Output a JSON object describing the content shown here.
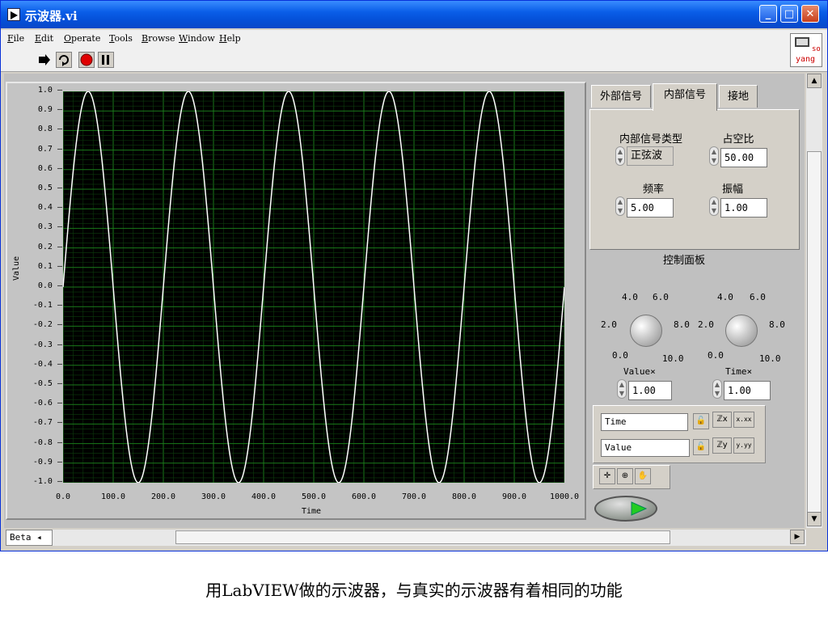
{
  "window": {
    "title": "示波器.vi",
    "controls": {
      "minimize": "_",
      "maximize": "□",
      "close": "✕"
    }
  },
  "menu": [
    {
      "hot": "F",
      "rest": "ile"
    },
    {
      "hot": "E",
      "rest": "dit"
    },
    {
      "hot": "O",
      "rest": "perate"
    },
    {
      "hot": "T",
      "rest": "ools"
    },
    {
      "hot": "B",
      "rest": "rowse"
    },
    {
      "hot": "W",
      "rest": "indow"
    },
    {
      "hot": "H",
      "rest": "elp"
    }
  ],
  "toolbar": {
    "run_icon": "run-arrow-icon",
    "run_continuous_icon": "run-continuously-icon",
    "abort_icon": "abort-icon",
    "pause_icon": "pause-icon"
  },
  "vi_icon_text": {
    "line1": "so",
    "line2": "yang"
  },
  "graph": {
    "xlabel": "Time",
    "ylabel": "Value",
    "xticks": [
      "0.0",
      "100.0",
      "200.0",
      "300.0",
      "400.0",
      "500.0",
      "600.0",
      "700.0",
      "800.0",
      "900.0",
      "1000.0"
    ],
    "yticks": [
      "1.0",
      "0.9",
      "0.8",
      "0.7",
      "0.6",
      "0.5",
      "0.4",
      "0.3",
      "0.2",
      "0.1",
      "0.0",
      "-0.1",
      "-0.2",
      "-0.3",
      "-0.4",
      "-0.5",
      "-0.6",
      "-0.7",
      "-0.8",
      "-0.9",
      "-1.0"
    ]
  },
  "chart_data": {
    "type": "line",
    "xlabel": "Time",
    "ylabel": "Value",
    "xlim": [
      0,
      1000
    ],
    "ylim": [
      -1,
      1
    ],
    "grid": true,
    "series": [
      {
        "frequency": 5,
        "amplitude": 1,
        "period": 200
      }
    ],
    "colors": {
      "background": "#000000",
      "grid": "#1a7a1a",
      "line": "#ffffff"
    }
  },
  "tabs": [
    {
      "label": "外部信号"
    },
    {
      "label": "内部信号"
    },
    {
      "label": "接地"
    }
  ],
  "internal_signal": {
    "type_label": "内部信号类型",
    "type_value": "正弦波",
    "duty_label": "占空比",
    "duty_value": "50.00",
    "freq_label": "频率",
    "freq_value": "5.00",
    "amp_label": "振幅",
    "amp_value": "1.00"
  },
  "control_panel_label": "控制面板",
  "knobs": [
    {
      "label": "Value×",
      "value": "1.00",
      "scale": {
        "s4": "4.0",
        "s6": "6.0",
        "s2": "2.0",
        "s8": "8.0",
        "s0": "0.0",
        "s10": "10.0"
      }
    },
    {
      "label": "Time×",
      "value": "1.00",
      "scale": {
        "s4": "4.0",
        "s6": "6.0",
        "s2": "2.0",
        "s8": "8.0",
        "s0": "0.0",
        "s10": "10.0"
      }
    }
  ],
  "cursor_legend": {
    "x_name": "Time",
    "y_name": "Value",
    "x_format": "x.xx",
    "y_format": "y.yy"
  },
  "beta_label": "Beta",
  "caption": "用LabVIEW做的示波器，与真实的示波器有着相同的功能"
}
